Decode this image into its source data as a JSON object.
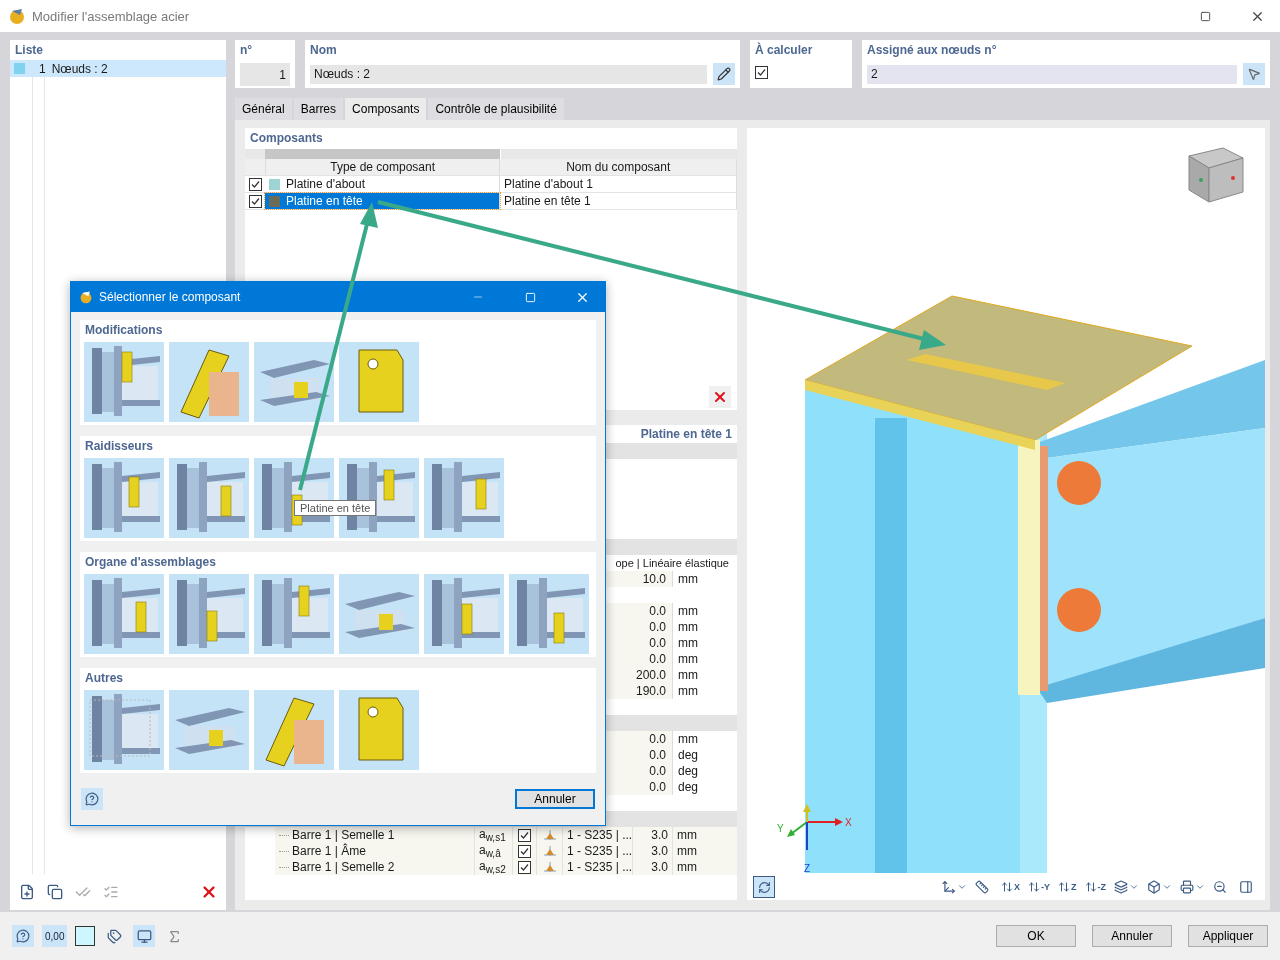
{
  "window": {
    "title": "Modifier l'assemblage acier"
  },
  "list": {
    "title": "Liste",
    "items": [
      {
        "number": "1",
        "name": "Nœuds : 2",
        "color": "#7fd3ee",
        "selected": true
      }
    ]
  },
  "header": {
    "number": {
      "label": "n°",
      "value": "1"
    },
    "name": {
      "label": "Nom",
      "value": "Nœuds : 2"
    },
    "calculate": {
      "label": "À calculer",
      "checked": true
    },
    "assigned": {
      "label": "Assigné aux nœuds n°",
      "value": "2"
    }
  },
  "tabs": [
    {
      "label": "Général",
      "selected": false
    },
    {
      "label": "Barres",
      "selected": false
    },
    {
      "label": "Composants",
      "selected": true
    },
    {
      "label": "Contrôle de plausibilité",
      "selected": false
    }
  ],
  "components": {
    "title": "Composants",
    "columns": [
      "Type de composant",
      "Nom du composant"
    ],
    "rows": [
      {
        "checked": true,
        "type": "Platine d'about",
        "color": "#9fd4d4",
        "name": "Platine d'about 1",
        "selected": false
      },
      {
        "checked": true,
        "type": "Platine en tête",
        "color": "#6b6b5a",
        "name": "Platine en tête 1",
        "selected": true
      }
    ]
  },
  "details": {
    "title": "Platine en tête 1",
    "sections": [
      {
        "rows": [
          {
            "kind": "spacer"
          },
          {
            "kind": "spacer"
          },
          {
            "kind": "spacer"
          },
          {
            "kind": "spacer"
          },
          {
            "kind": "spacer"
          }
        ]
      },
      {
        "rows": [
          {
            "kind": "text",
            "text": "ope | Linéaire élastique"
          },
          {
            "kind": "value",
            "value": "10.0",
            "unit": "mm"
          },
          {
            "kind": "spacer"
          },
          {
            "kind": "value",
            "value": "0.0",
            "unit": "mm"
          },
          {
            "kind": "value",
            "value": "0.0",
            "unit": "mm"
          },
          {
            "kind": "value",
            "value": "0.0",
            "unit": "mm"
          },
          {
            "kind": "value",
            "value": "0.0",
            "unit": "mm"
          },
          {
            "kind": "value",
            "value": "200.0",
            "unit": "mm"
          },
          {
            "kind": "value",
            "value": "190.0",
            "unit": "mm"
          },
          {
            "kind": "spacer"
          }
        ]
      },
      {
        "rows": [
          {
            "kind": "value",
            "value": "0.0",
            "unit": "mm"
          },
          {
            "kind": "value",
            "value": "0.0",
            "unit": "deg"
          },
          {
            "kind": "value",
            "value": "0.0",
            "unit": "deg"
          },
          {
            "kind": "value",
            "value": "0.0",
            "unit": "deg"
          },
          {
            "kind": "spacer"
          }
        ]
      }
    ],
    "welds": [
      {
        "member": "Barre 1 | Semelle 1",
        "symbol": "a$_{w,s1}$",
        "checked": true,
        "material": "1 - S235 | ...",
        "value": "3.0",
        "unit": "mm"
      },
      {
        "member": "Barre 1 | Âme",
        "symbol": "a$_{w,â}$",
        "checked": true,
        "material": "1 - S235 | ...",
        "value": "3.0",
        "unit": "mm"
      },
      {
        "member": "Barre 1 | Semelle 2",
        "symbol": "a$_{w,s2}$",
        "checked": true,
        "material": "1 - S235 | ...",
        "value": "3.0",
        "unit": "mm"
      }
    ]
  },
  "view": {
    "axes": {
      "x": "X",
      "y": "Y",
      "z": "Z"
    },
    "toolbar_labels": [
      "X",
      "-Y",
      "Z",
      "-Z"
    ]
  },
  "dialog": {
    "title": "Sélectionner le composant",
    "sections": [
      {
        "title": "Modifications",
        "tiles": [
          {
            "kind": "joint"
          },
          {
            "kind": "plate"
          },
          {
            "kind": "beam"
          },
          {
            "kind": "sheet"
          }
        ]
      },
      {
        "title": "Raidisseurs",
        "tiles": [
          {
            "kind": "joint"
          },
          {
            "kind": "joint"
          },
          {
            "kind": "joint",
            "tooltip": "Platine en tête"
          },
          {
            "kind": "joint"
          },
          {
            "kind": "joint"
          }
        ]
      },
      {
        "title": "Organe d'assemblages",
        "tiles": [
          {
            "kind": "joint"
          },
          {
            "kind": "joint"
          },
          {
            "kind": "joint"
          },
          {
            "kind": "beam"
          },
          {
            "kind": "joint"
          },
          {
            "kind": "joint"
          }
        ]
      },
      {
        "title": "Autres",
        "tiles": [
          {
            "kind": "mesh"
          },
          {
            "kind": "beam"
          },
          {
            "kind": "plate"
          },
          {
            "kind": "sheet"
          }
        ]
      }
    ],
    "cancel": "Annuler"
  },
  "status_bar": {
    "decimals": "0,00",
    "buttons": [
      "OK",
      "Annuler",
      "Appliquer"
    ]
  }
}
